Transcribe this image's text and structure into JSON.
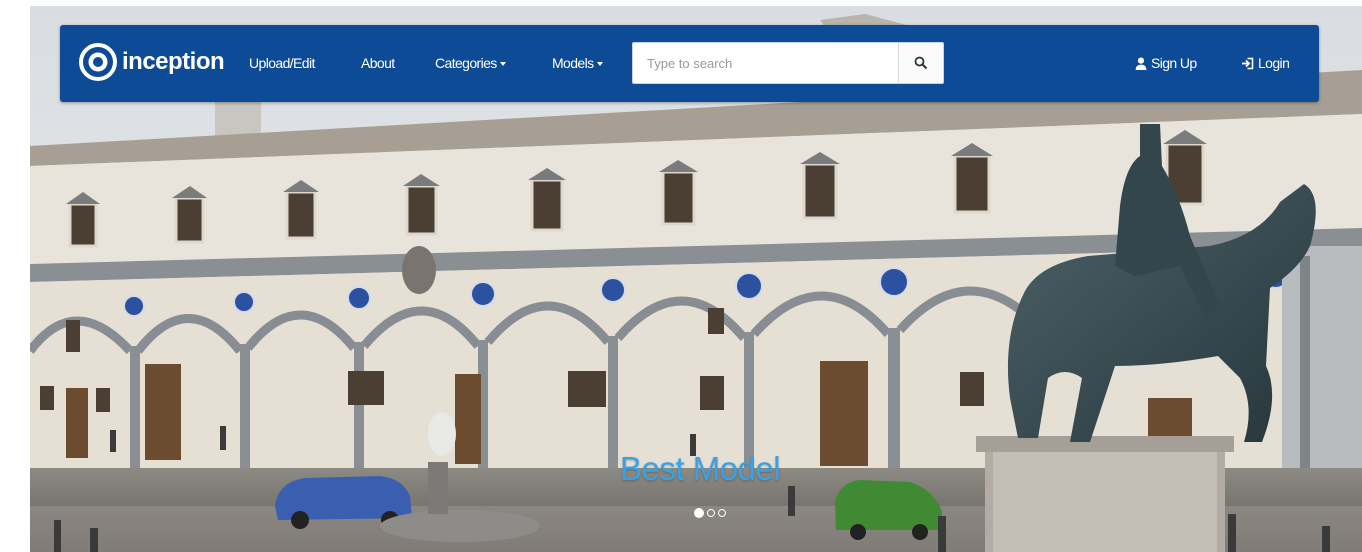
{
  "navbar": {
    "brand": "inception",
    "links": {
      "upload": "Upload/Edit",
      "about": "About",
      "categories": "Categories",
      "models": "Models"
    },
    "search": {
      "placeholder": "Type to search",
      "value": ""
    },
    "signup": "Sign Up",
    "login": "Login"
  },
  "carousel": {
    "caption": "Best Model",
    "slides_total": 3,
    "active_slide": 1
  },
  "colors": {
    "navbar": "#0d4b96",
    "caption": "#37a2e6"
  },
  "icons": [
    "inception-logo-icon",
    "caret-down-icon",
    "search-icon",
    "user-icon",
    "login-icon"
  ]
}
